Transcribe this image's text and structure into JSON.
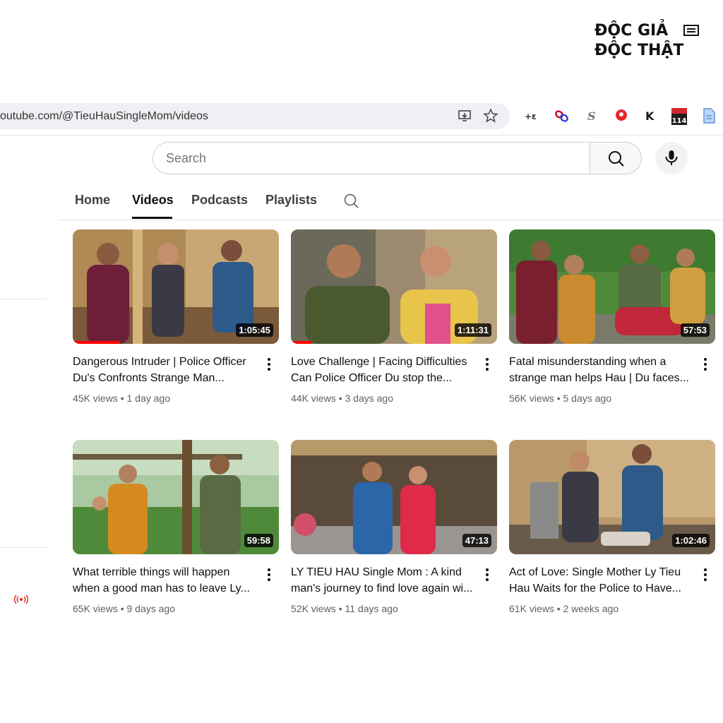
{
  "watermark": {
    "line1": "ĐỘC GIẢ",
    "line2": "ĐỘC THẬT"
  },
  "browser": {
    "url": "outube.com/@TieuHauSingleMom/videos",
    "extensions": [
      "back-forth-icon",
      "link-icon",
      "s-icon",
      "red-pin-icon",
      "k-icon",
      "calendar-icon",
      "doc-icon"
    ],
    "calendar_badge": "114"
  },
  "search": {
    "placeholder": "Search"
  },
  "tabs": [
    {
      "label": "Home",
      "active": false
    },
    {
      "label": "Videos",
      "active": true
    },
    {
      "label": "Podcasts",
      "active": false
    },
    {
      "label": "Playlists",
      "active": false
    }
  ],
  "videos": [
    {
      "title_line1": "Dangerous Intruder | Police Officer",
      "title_line2": "Du's Confronts Strange Man...",
      "views": "45K views",
      "age": "1 day ago",
      "duration": "1:05:45",
      "watched": 0.23
    },
    {
      "title_line1": "Love Challenge | Facing Difficulties",
      "title_line2": "Can Police Officer Du stop the...",
      "views": "44K views",
      "age": "3 days ago",
      "duration": "1:11:31",
      "watched": 0.1
    },
    {
      "title_line1": "Fatal misunderstanding when a",
      "title_line2": "strange man helps Hau | Du faces...",
      "views": "56K views",
      "age": "5 days ago",
      "duration": "57:53",
      "watched": 0
    },
    {
      "title_line1": "What terrible things will happen",
      "title_line2": "when a good man has to leave Ly...",
      "views": "65K views",
      "age": "9 days ago",
      "duration": "59:58",
      "watched": 0
    },
    {
      "title_line1": "LY TIEU HAU Single Mom : A kind",
      "title_line2": "man's journey to find love again wi...",
      "views": "52K views",
      "age": "11 days ago",
      "duration": "47:13",
      "watched": 0
    },
    {
      "title_line1": "Act of Love: Single Mother Ly Tieu",
      "title_line2": "Hau Waits for the Police to Have...",
      "views": "61K views",
      "age": "2 weeks ago",
      "duration": "1:02:46",
      "watched": 0
    }
  ],
  "colors": {
    "accent": "#ff0000",
    "text": "#0f0f0f",
    "meta": "#606060"
  }
}
